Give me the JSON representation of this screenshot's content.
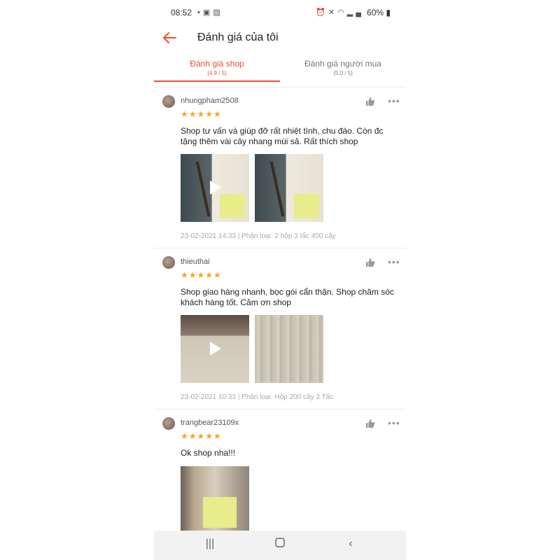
{
  "status_bar": {
    "time": "08:52",
    "battery": "60%",
    "left_icons": [
      "notification-icon",
      "calendar-icon",
      "image-icon"
    ],
    "right_icons": [
      "alarm-icon",
      "mute-icon",
      "wifi-icon",
      "signal-icon",
      "battery-icon"
    ]
  },
  "header": {
    "title": "Đánh giá của tôi",
    "back_icon": "arrow-left-icon"
  },
  "tabs": [
    {
      "label": "Đánh giá shop",
      "sub": "(4.9 / 5)",
      "active": true
    },
    {
      "label": "Đánh giá người mua",
      "sub": "(5.0 / 5)",
      "active": false
    }
  ],
  "reviews": [
    {
      "username": "nhungpham2508",
      "stars": "★★★★★",
      "rating": 5,
      "text": "Shop tư vấn và giúp đỡ rất nhiệt tình, chu đáo. Còn đc tặng thêm vài cây nhang mùi sả. Rất thích shop",
      "meta": "23-02-2021 14:33 | Phân loại: 2 hộp 3 tấc 400 cây",
      "photos": [
        "video",
        "photo"
      ]
    },
    {
      "username": "thieuthai",
      "stars": "★★★★★",
      "rating": 5,
      "text": "Shop giao hàng nhanh, bọc gói cẩn thận. Shop chăm sóc khách hàng tốt. Cảm ơn shop",
      "meta": "23-02-2021 10:33 | Phân loại: Hộp 200 cây 3 Tấc",
      "photos": [
        "video",
        "photo"
      ]
    },
    {
      "username": "trangbear23109x",
      "stars": "★★★★★",
      "rating": 5,
      "text": "Ok shop nha!!!",
      "meta": "",
      "photos": [
        "photo"
      ]
    }
  ],
  "nav_bar": {
    "recent_icon": "|||",
    "home_icon": "home-icon",
    "back_icon": "‹"
  },
  "colors": {
    "accent": "#ee4d2d",
    "star": "#f5a623",
    "text": "#222222",
    "muted": "#aaaaaa"
  }
}
